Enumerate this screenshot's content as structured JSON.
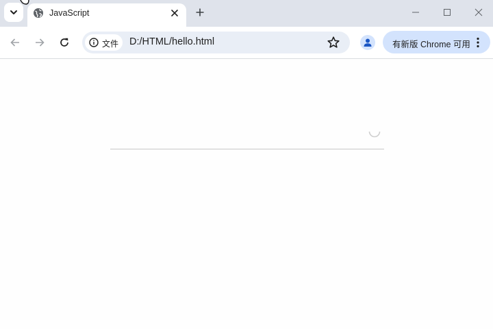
{
  "tab": {
    "title": "JavaScript"
  },
  "omnibox": {
    "chip_label": "文件",
    "url": "D:/HTML/hello.html"
  },
  "update_button": {
    "label": "有新版 Chrome 可用"
  },
  "icons": {
    "tab_search": "chevron-down-icon",
    "favicon": "globe-icon",
    "tab_close": "close-icon",
    "new_tab": "plus-icon",
    "back": "arrow-left-icon",
    "forward": "arrow-right-icon",
    "reload": "reload-icon",
    "info": "info-icon",
    "bookmark": "star-icon",
    "profile": "person-icon",
    "menu": "kebab-icon"
  },
  "colors": {
    "tabstrip": "#dfe3eb",
    "omnibox": "#e9eef6",
    "update_button": "#d3e3fd"
  }
}
